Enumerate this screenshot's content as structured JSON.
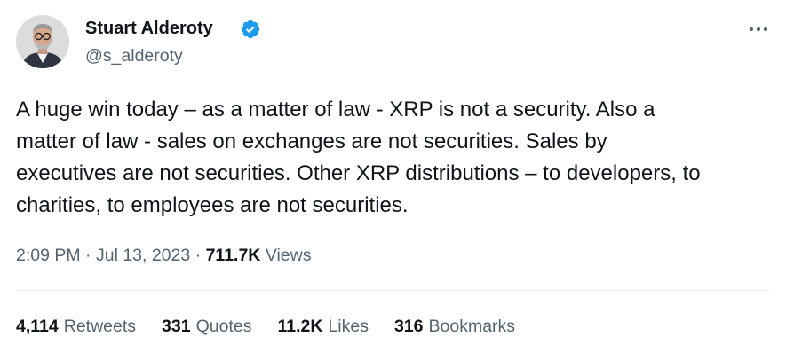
{
  "author": {
    "name": "Stuart Alderoty",
    "handle": "@s_alderoty",
    "verified_color": "#1d9bf0"
  },
  "tweet": {
    "text_lines": [
      "A huge win today – as a matter of law - XRP is not a security. Also a",
      "matter of law - sales on exchanges are not securities. Sales by",
      "executives are not securities. Other XRP distributions – to developers, to",
      "charities, to employees are not securities."
    ],
    "time": "2:09 PM",
    "date": "Jul 13, 2023",
    "views_count": "711.7K",
    "views_label": "Views"
  },
  "stats": [
    {
      "count": "4,114",
      "label": "Retweets"
    },
    {
      "count": "331",
      "label": "Quotes"
    },
    {
      "count": "11.2K",
      "label": "Likes"
    },
    {
      "count": "316",
      "label": "Bookmarks"
    }
  ],
  "icons": {
    "more": "more-icon",
    "verified": "verified-badge-icon"
  },
  "colors": {
    "text_primary": "#0f1419",
    "text_secondary": "#536471",
    "divider": "#eff3f4"
  }
}
